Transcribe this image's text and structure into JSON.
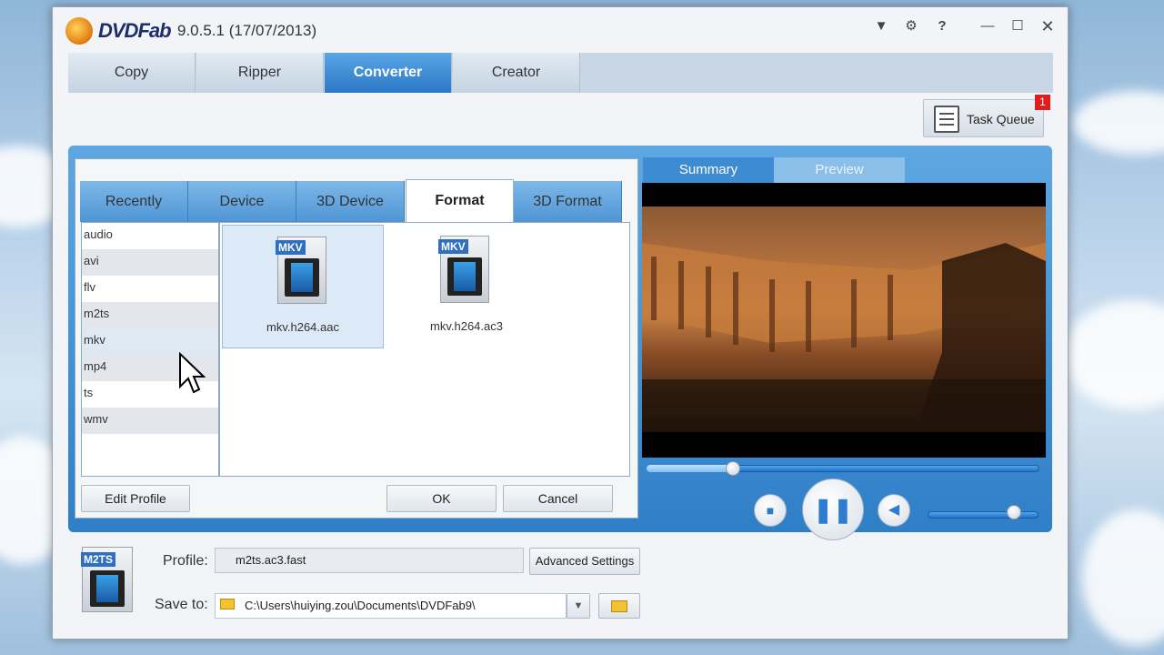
{
  "window": {
    "app_name": "DVDFab",
    "version": "9.0.5.1 (17/07/2013)",
    "controls": [
      "dropdown-icon",
      "gear-icon",
      "help-icon",
      "minimize-icon",
      "maximize-icon",
      "close-icon"
    ]
  },
  "main_tabs": [
    {
      "label": "Copy",
      "active": false
    },
    {
      "label": "Ripper",
      "active": false
    },
    {
      "label": "Converter",
      "active": true
    },
    {
      "label": "Creator",
      "active": false
    }
  ],
  "task_queue": {
    "label": "Task Queue",
    "badge": "1"
  },
  "profile_panel": {
    "tabs": [
      {
        "label": "Recently",
        "active": false
      },
      {
        "label": "Device",
        "active": false
      },
      {
        "label": "3D Device",
        "active": false
      },
      {
        "label": "Format",
        "active": true
      },
      {
        "label": "3D Format",
        "active": false
      }
    ],
    "categories": [
      "audio",
      "avi",
      "flv",
      "m2ts",
      "mkv",
      "mp4",
      "ts",
      "wmv"
    ],
    "selected_category": "mkv",
    "formats": [
      {
        "tag": "MKV",
        "name": "mkv.h264.aac",
        "selected": true
      },
      {
        "tag": "MKV",
        "name": "mkv.h264.ac3",
        "selected": false
      }
    ],
    "buttons": {
      "edit_profile": "Edit Profile",
      "ok": "OK",
      "cancel": "Cancel"
    }
  },
  "preview_panel": {
    "tabs": [
      {
        "label": "Summary",
        "active": false
      },
      {
        "label": "Preview",
        "active": true
      }
    ],
    "seek_progress": 0.22,
    "volume_level": 0.78
  },
  "bottom": {
    "icon_tag": "M2TS",
    "profile_label": "Profile:",
    "profile_value": "m2ts.ac3.fast",
    "advanced_settings": "Advanced Settings",
    "save_to_label": "Save to:",
    "save_to_value": "C:\\Users\\huiying.zou\\Documents\\DVDFab9\\"
  },
  "colors": {
    "accent": "#2a79c6",
    "badge": "#e21b1b"
  }
}
